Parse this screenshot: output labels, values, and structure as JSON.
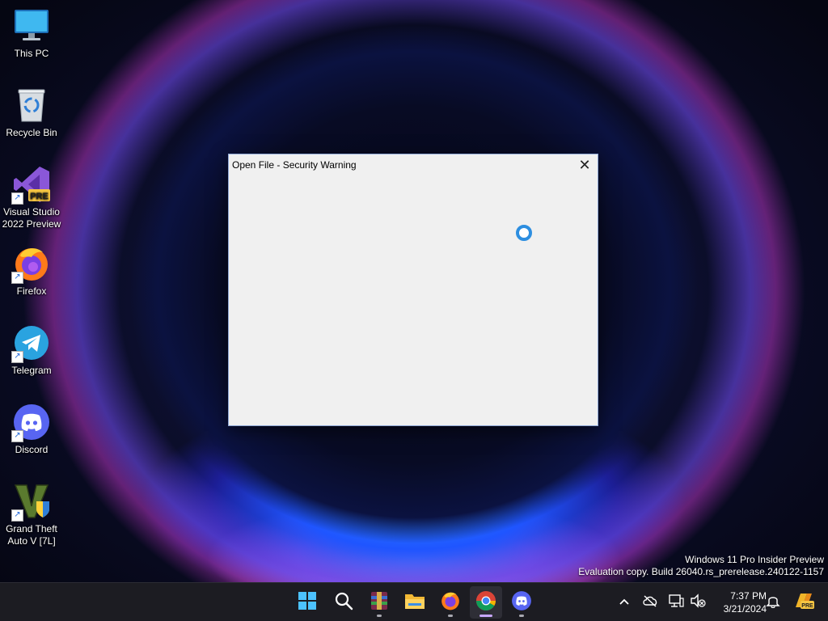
{
  "desktop": {
    "icons": [
      {
        "label": "This PC",
        "icon": "monitor-icon"
      },
      {
        "label": "Recycle Bin",
        "icon": "recycle-bin-icon"
      },
      {
        "label": "Visual Studio 2022 Preview",
        "icon": "visual-studio-icon",
        "badge": "PRE"
      },
      {
        "label": "Firefox",
        "icon": "firefox-icon"
      },
      {
        "label": "Telegram",
        "icon": "telegram-icon"
      },
      {
        "label": "Discord",
        "icon": "discord-icon"
      },
      {
        "label": "Grand Theft Auto V [7L]",
        "icon": "gta-icon"
      }
    ],
    "shortcut_arrow": "↗"
  },
  "dialog": {
    "title": "Open File - Security Warning",
    "close_glyph": "✕",
    "state": "loading"
  },
  "watermark": {
    "line1": "Windows 11 Pro Insider Preview",
    "line2": "Evaluation copy. Build 26040.rs_prerelease.240122-1157"
  },
  "taskbar": {
    "apps": [
      {
        "name": "start",
        "icon": "windows-start-icon"
      },
      {
        "name": "search",
        "icon": "search-icon"
      },
      {
        "name": "winrar",
        "icon": "winrar-icon"
      },
      {
        "name": "file-explorer",
        "icon": "folder-icon"
      },
      {
        "name": "firefox",
        "icon": "firefox-icon"
      },
      {
        "name": "chrome",
        "icon": "chrome-icon",
        "active": true
      },
      {
        "name": "discord",
        "icon": "discord-icon"
      }
    ],
    "tray": {
      "chevron": "^",
      "icons": [
        "onedrive-offline-icon",
        "network-icon",
        "volume-muted-icon"
      ],
      "time": "7:37 PM",
      "date": "3/21/2024",
      "notification_icon": "bell-icon",
      "copilot_badge": "PRE"
    }
  },
  "colors": {
    "dialog_bg": "#f0f0f0",
    "spinner": "#2d8ee0",
    "taskbar_bg": "#1c1c22",
    "active_indicator": "#c8a8ff"
  }
}
